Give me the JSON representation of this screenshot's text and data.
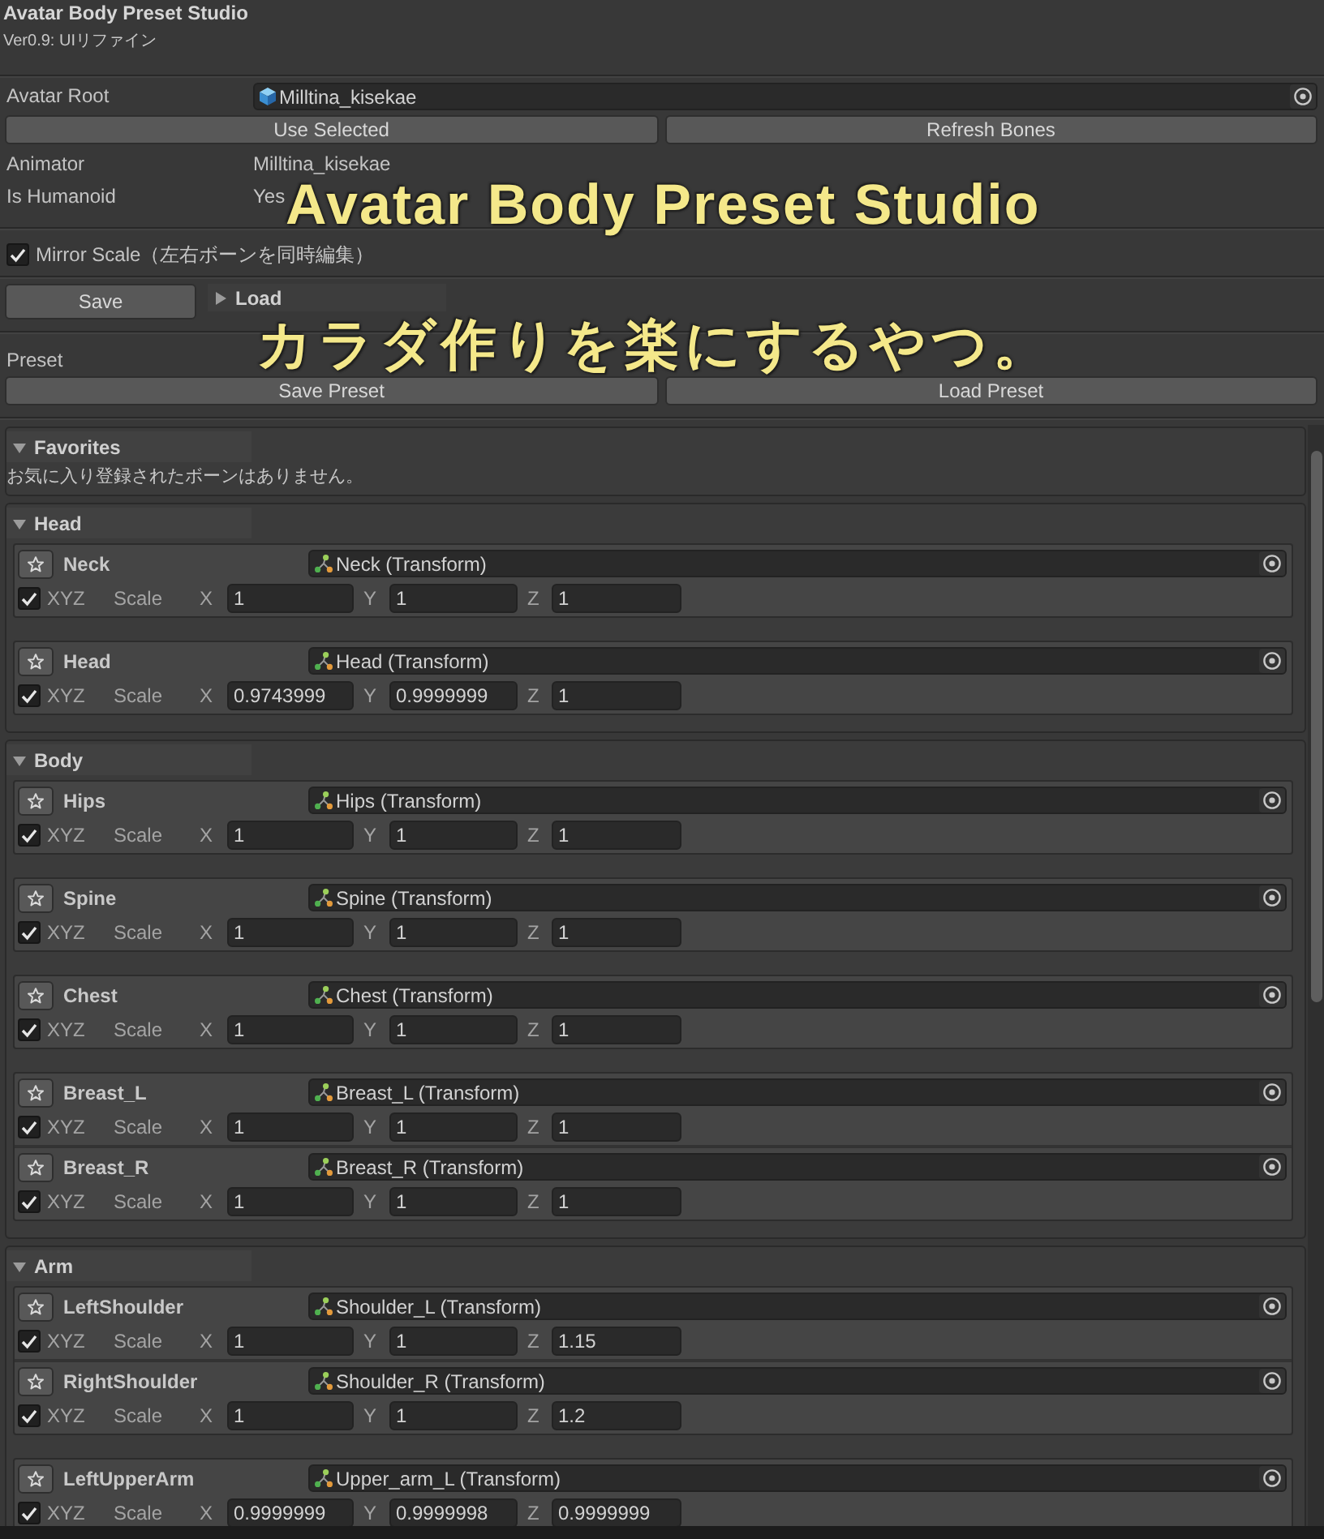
{
  "window": {
    "title": "Avatar Body Preset Studio",
    "version": "Ver0.9: UIリファイン"
  },
  "avatar": {
    "root": {
      "label": "Avatar Root",
      "value": "Milltina_kisekae"
    },
    "buttons": [
      "Use Selected",
      "Refresh Bones"
    ],
    "info": [
      {
        "label": "Animator",
        "value": "Milltina_kisekae"
      },
      {
        "label": "Is Humanoid",
        "value": "Yes"
      }
    ]
  },
  "mirror_scale": {
    "label": "Mirror Scale（左右ボーンを同時編集）",
    "checked": true
  },
  "save_button": "Save",
  "load_foldout": {
    "label": "Load",
    "expanded": false
  },
  "preset": {
    "label": "Preset",
    "buttons": [
      "Save Preset",
      "Load Preset"
    ]
  },
  "groups": [
    {
      "kind": "message",
      "title": "Favorites",
      "expanded": true,
      "message": "お気に入り登録されたボーンはありません。"
    },
    {
      "kind": "bones",
      "title": "Head",
      "expanded": true,
      "blocks": [
        {
          "bones": [
            {
              "name": "Neck",
              "target": "Neck (Transform)",
              "xyz": {
                "label": "XYZ",
                "checked": true
              },
              "scale_label": "Scale",
              "axes": [
                {
                  "label": "X",
                  "value": "1"
                },
                {
                  "label": "Y",
                  "value": "1"
                },
                {
                  "label": "Z",
                  "value": "1"
                }
              ]
            }
          ]
        },
        {
          "bones": [
            {
              "name": "Head",
              "target": "Head (Transform)",
              "xyz": {
                "label": "XYZ",
                "checked": true
              },
              "scale_label": "Scale",
              "axes": [
                {
                  "label": "X",
                  "value": "0.9743999"
                },
                {
                  "label": "Y",
                  "value": "0.9999999"
                },
                {
                  "label": "Z",
                  "value": "1"
                }
              ]
            }
          ]
        }
      ]
    },
    {
      "kind": "bones",
      "title": "Body",
      "expanded": true,
      "blocks": [
        {
          "bones": [
            {
              "name": "Hips",
              "target": "Hips (Transform)",
              "xyz": {
                "label": "XYZ",
                "checked": true
              },
              "scale_label": "Scale",
              "axes": [
                {
                  "label": "X",
                  "value": "1"
                },
                {
                  "label": "Y",
                  "value": "1"
                },
                {
                  "label": "Z",
                  "value": "1"
                }
              ]
            }
          ]
        },
        {
          "bones": [
            {
              "name": "Spine",
              "target": "Spine (Transform)",
              "xyz": {
                "label": "XYZ",
                "checked": true
              },
              "scale_label": "Scale",
              "axes": [
                {
                  "label": "X",
                  "value": "1"
                },
                {
                  "label": "Y",
                  "value": "1"
                },
                {
                  "label": "Z",
                  "value": "1"
                }
              ]
            }
          ]
        },
        {
          "bones": [
            {
              "name": "Chest",
              "target": "Chest (Transform)",
              "xyz": {
                "label": "XYZ",
                "checked": true
              },
              "scale_label": "Scale",
              "axes": [
                {
                  "label": "X",
                  "value": "1"
                },
                {
                  "label": "Y",
                  "value": "1"
                },
                {
                  "label": "Z",
                  "value": "1"
                }
              ]
            }
          ]
        },
        {
          "bones": [
            {
              "name": "Breast_L",
              "target": "Breast_L (Transform)",
              "xyz": {
                "label": "XYZ",
                "checked": true
              },
              "scale_label": "Scale",
              "axes": [
                {
                  "label": "X",
                  "value": "1"
                },
                {
                  "label": "Y",
                  "value": "1"
                },
                {
                  "label": "Z",
                  "value": "1"
                }
              ]
            },
            {
              "name": "Breast_R",
              "target": "Breast_R (Transform)",
              "xyz": {
                "label": "XYZ",
                "checked": true
              },
              "scale_label": "Scale",
              "axes": [
                {
                  "label": "X",
                  "value": "1"
                },
                {
                  "label": "Y",
                  "value": "1"
                },
                {
                  "label": "Z",
                  "value": "1"
                }
              ]
            }
          ]
        }
      ]
    },
    {
      "kind": "bones",
      "title": "Arm",
      "expanded": true,
      "blocks": [
        {
          "bones": [
            {
              "name": "LeftShoulder",
              "target": "Shoulder_L (Transform)",
              "xyz": {
                "label": "XYZ",
                "checked": true
              },
              "scale_label": "Scale",
              "axes": [
                {
                  "label": "X",
                  "value": "1"
                },
                {
                  "label": "Y",
                  "value": "1"
                },
                {
                  "label": "Z",
                  "value": "1.15"
                }
              ]
            },
            {
              "name": "RightShoulder",
              "target": "Shoulder_R (Transform)",
              "xyz": {
                "label": "XYZ",
                "checked": true
              },
              "scale_label": "Scale",
              "axes": [
                {
                  "label": "X",
                  "value": "1"
                },
                {
                  "label": "Y",
                  "value": "1"
                },
                {
                  "label": "Z",
                  "value": "1.2"
                }
              ]
            }
          ]
        },
        {
          "bones": [
            {
              "name": "LeftUpperArm",
              "target": "Upper_arm_L (Transform)",
              "xyz": {
                "label": "XYZ",
                "checked": true
              },
              "scale_label": "Scale",
              "axes": [
                {
                  "label": "X",
                  "value": "0.9999999"
                },
                {
                  "label": "Y",
                  "value": "0.9999998"
                },
                {
                  "label": "Z",
                  "value": "0.9999999"
                }
              ]
            }
          ]
        }
      ]
    }
  ],
  "overlay": {
    "title": "Avatar Body Preset Studio",
    "subtitle": "カラダ作りを楽にするやつ。"
  }
}
